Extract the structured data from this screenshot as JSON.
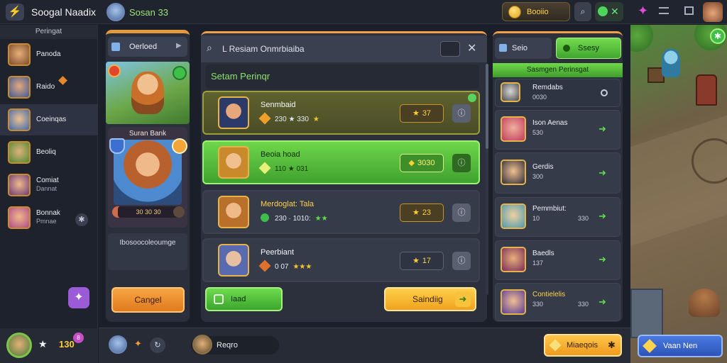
{
  "topbar": {
    "app_title": "Soogal Naadix",
    "player_name": "Sosan 33",
    "gold_label": "Booiio",
    "gold_icon": "coin-icon"
  },
  "sidebar": {
    "header": "Peringat",
    "items": [
      {
        "label": "Panoda",
        "sub": ""
      },
      {
        "label": "Raido",
        "sub": ""
      },
      {
        "label": "Coeinqas",
        "sub": ""
      },
      {
        "label": "Beoliq",
        "sub": ""
      },
      {
        "label": "Comiat",
        "sub": "Dannat"
      },
      {
        "label": "Bonnak",
        "sub": "Pmnae"
      }
    ],
    "footer_count": "130",
    "footer_badge": "8"
  },
  "character": {
    "select_label": "Oerloed",
    "card_title": "Suran Bank",
    "stats": "30 30 30",
    "description": "Ibosoocoleoumge",
    "cancel_label": "Cangel"
  },
  "modal": {
    "search_text": "L Resiam Onmrbiaiba",
    "section_title": "Setam Perinqr",
    "missions": [
      {
        "title": "Senmbaid",
        "reward": "230 ★ 330",
        "stars": "★",
        "score": "37",
        "gem_color": "#f0a02a",
        "style": "gold"
      },
      {
        "title": "Beoia hoad",
        "reward": "110 ★ 031",
        "stars": "",
        "score": "3030",
        "gem_color": "#e8f07a",
        "style": "green"
      },
      {
        "title": "Merdoglat: Tala",
        "reward": "230 · 1010:",
        "stars": "★★",
        "score": "23",
        "gem_color": "#3fbf4a",
        "style": "normal"
      },
      {
        "title": "Peerbiant",
        "reward": "0 07",
        "stars": "★★★",
        "score": "17",
        "gem_color": "#e0702a",
        "style": "normal"
      }
    ],
    "add_label": "Iaad",
    "confirm_label": "Saindiig"
  },
  "right_panel": {
    "tab1": "Seio",
    "tab2": "Ssesy",
    "header": "Sasmgen Perinsgat",
    "rows": [
      {
        "name": "Remdabs",
        "val": "0030",
        "val2": "",
        "action": "ring"
      },
      {
        "name": "Ison Aenas",
        "val": "530",
        "val2": "",
        "action": "arrow"
      },
      {
        "name": "Gerdis",
        "val": "300",
        "val2": "",
        "action": "arrow"
      },
      {
        "name": "Pemmbiut:",
        "val": "10",
        "val2": "330",
        "action": "arrow"
      },
      {
        "name": "Baedls",
        "val": "137",
        "val2": "",
        "action": "arrow"
      },
      {
        "name": "Contielelis",
        "val": "330",
        "val2": "330",
        "action": "arrow"
      }
    ]
  },
  "bottom": {
    "chat_text": "Reqro",
    "missions_label": "Miaeqois"
  },
  "map": {
    "mode_label": "Vaan Nen"
  }
}
